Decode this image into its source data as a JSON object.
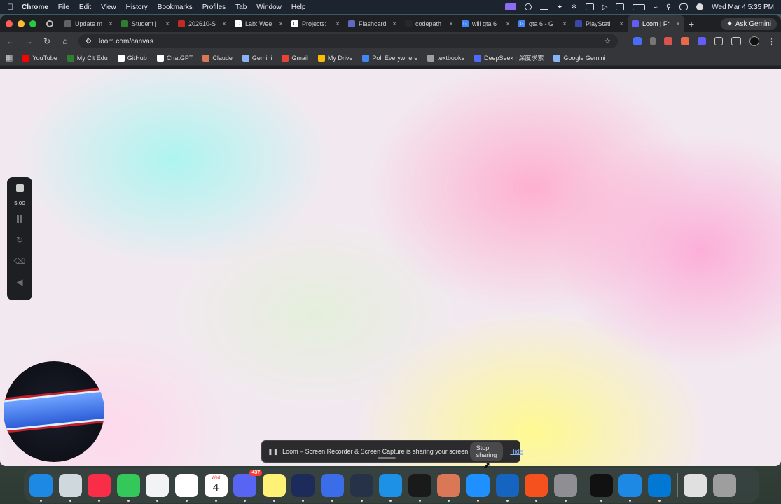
{
  "menubar": {
    "app_name": "Chrome",
    "menus": [
      "File",
      "Edit",
      "View",
      "History",
      "Bookmarks",
      "Profiles",
      "Tab",
      "Window",
      "Help"
    ],
    "clock": "Wed Mar 4  5:35 PM"
  },
  "tabs": [
    {
      "label": "Update m",
      "color": "#5f6368",
      "glyph": ""
    },
    {
      "label": "Student |",
      "color": "#2e7d32",
      "glyph": ""
    },
    {
      "label": "202610-S",
      "color": "#c62828",
      "glyph": ""
    },
    {
      "label": "Lab: Wee",
      "color": "#ffffff",
      "glyph": "C"
    },
    {
      "label": "Projects:",
      "color": "#ffffff",
      "glyph": "C"
    },
    {
      "label": "Flashcard",
      "color": "#5c6bc0",
      "glyph": ""
    },
    {
      "label": "codepath",
      "color": "#24292e",
      "glyph": ""
    },
    {
      "label": "will gta 6",
      "color": "#4285f4",
      "glyph": "G"
    },
    {
      "label": "gta 6 - G",
      "color": "#4285f4",
      "glyph": "G"
    },
    {
      "label": "PlayStati",
      "color": "#3949ab",
      "glyph": ""
    },
    {
      "label": "Loom | Fr",
      "color": "#625df5",
      "glyph": ""
    }
  ],
  "ask_gemini_label": "Ask Gemini",
  "address_bar": {
    "url": "loom.com/canvas"
  },
  "bookmarks": [
    {
      "label": "YouTube",
      "color": "#ff0000"
    },
    {
      "label": "My Clt Edu",
      "color": "#2e7d32"
    },
    {
      "label": "GitHub",
      "color": "#ffffff"
    },
    {
      "label": "ChatGPT",
      "color": "#ffffff"
    },
    {
      "label": "Claude",
      "color": "#d97757"
    },
    {
      "label": "Gemini",
      "color": "#8ab4f8"
    },
    {
      "label": "Gmail",
      "color": "#ea4335"
    },
    {
      "label": "My Drive",
      "color": "#fbbc04"
    },
    {
      "label": "Poll Everywhere",
      "color": "#4285f4"
    },
    {
      "label": "textbooks",
      "color": "#9aa0a6"
    },
    {
      "label": "DeepSeek | 深度求索",
      "color": "#4d6bfe"
    },
    {
      "label": "Google Gemini",
      "color": "#8ab4f8"
    }
  ],
  "loom_controls": {
    "timer": "5:00"
  },
  "share_bar": {
    "message": "Loom – Screen Recorder & Screen Capture is sharing your screen.",
    "stop_label": "Stop sharing",
    "hide_label": "Hide"
  },
  "dock": {
    "calendar_day": "Wed",
    "calendar_date": "4",
    "discord_badge": "437",
    "apps": [
      {
        "name": "finder",
        "color": "#1e88e5"
      },
      {
        "name": "launchpad",
        "color": "#cfd8dc"
      },
      {
        "name": "music",
        "color": "#fa2d48"
      },
      {
        "name": "messages",
        "color": "#34c759"
      },
      {
        "name": "chrome",
        "color": "#f1f3f4"
      },
      {
        "name": "notion",
        "color": "#ffffff"
      },
      {
        "name": "calendar",
        "color": "#ffffff"
      },
      {
        "name": "discord",
        "color": "#5865f2"
      },
      {
        "name": "notes",
        "color": "#fff176"
      },
      {
        "name": "arc",
        "color": "#1d2b5b"
      },
      {
        "name": "zoom-meeting",
        "color": "#3b6de8"
      },
      {
        "name": "audio-meter",
        "color": "#263248"
      },
      {
        "name": "docker",
        "color": "#1d91e6"
      },
      {
        "name": "chatgpt",
        "color": "#1a1a1a"
      },
      {
        "name": "claude",
        "color": "#d97757"
      },
      {
        "name": "app-store",
        "color": "#1e90ff"
      },
      {
        "name": "xcode",
        "color": "#1565c0"
      },
      {
        "name": "swift-playgrounds",
        "color": "#f4511e"
      },
      {
        "name": "system-settings",
        "color": "#8e8e93"
      }
    ],
    "right_apps": [
      {
        "name": "terminal",
        "color": "#111111"
      },
      {
        "name": "windows-app",
        "color": "#1e88e5"
      },
      {
        "name": "vscode",
        "color": "#0078d4"
      }
    ]
  }
}
